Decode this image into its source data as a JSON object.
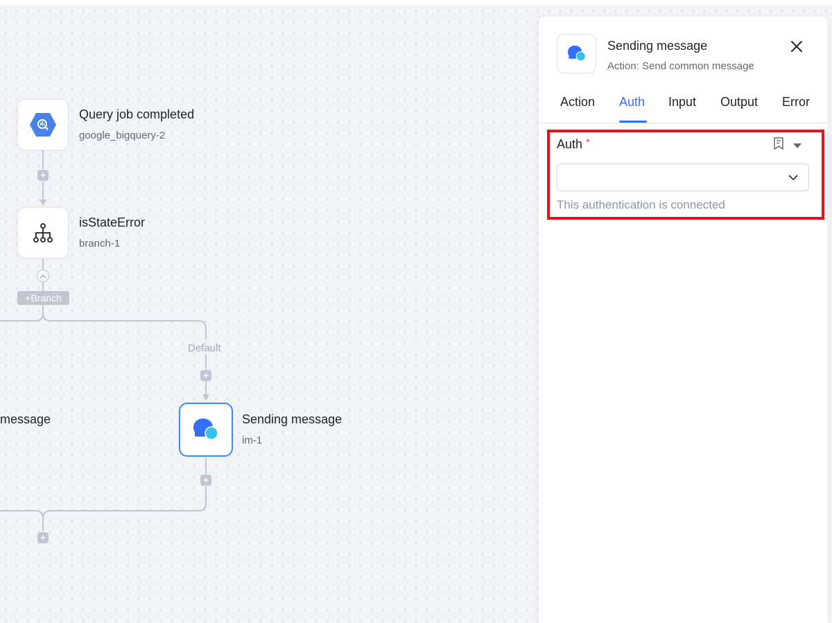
{
  "flow": {
    "nodes": [
      {
        "title": "Query job completed",
        "subtitle": "google_bigquery-2",
        "icon": "bigquery-icon"
      },
      {
        "title": "isStateError",
        "subtitle": "branch-1",
        "icon": "branch-tree-icon"
      },
      {
        "title": "Sending message",
        "subtitle": "im-1",
        "icon": "chat-bubble-icon",
        "selected": true
      }
    ],
    "partial_node_title": "message",
    "branch_button_label": "+Branch",
    "default_label": "Default",
    "plus_label": "+"
  },
  "panel": {
    "title": "Sending message",
    "subtitle": "Action: Send common message",
    "tabs": [
      {
        "label": "Action"
      },
      {
        "label": "Auth",
        "active": true
      },
      {
        "label": "Input"
      },
      {
        "label": "Output"
      },
      {
        "label": "Error"
      }
    ],
    "auth": {
      "label": "Auth",
      "required_mark": "*",
      "select_value": "",
      "hint": "This authentication is connected"
    }
  },
  "colors": {
    "accent": "#3370ff",
    "highlight_border": "#e8121d",
    "selected_node_border": "#3b8cf0",
    "connector": "#c2c6d2"
  }
}
